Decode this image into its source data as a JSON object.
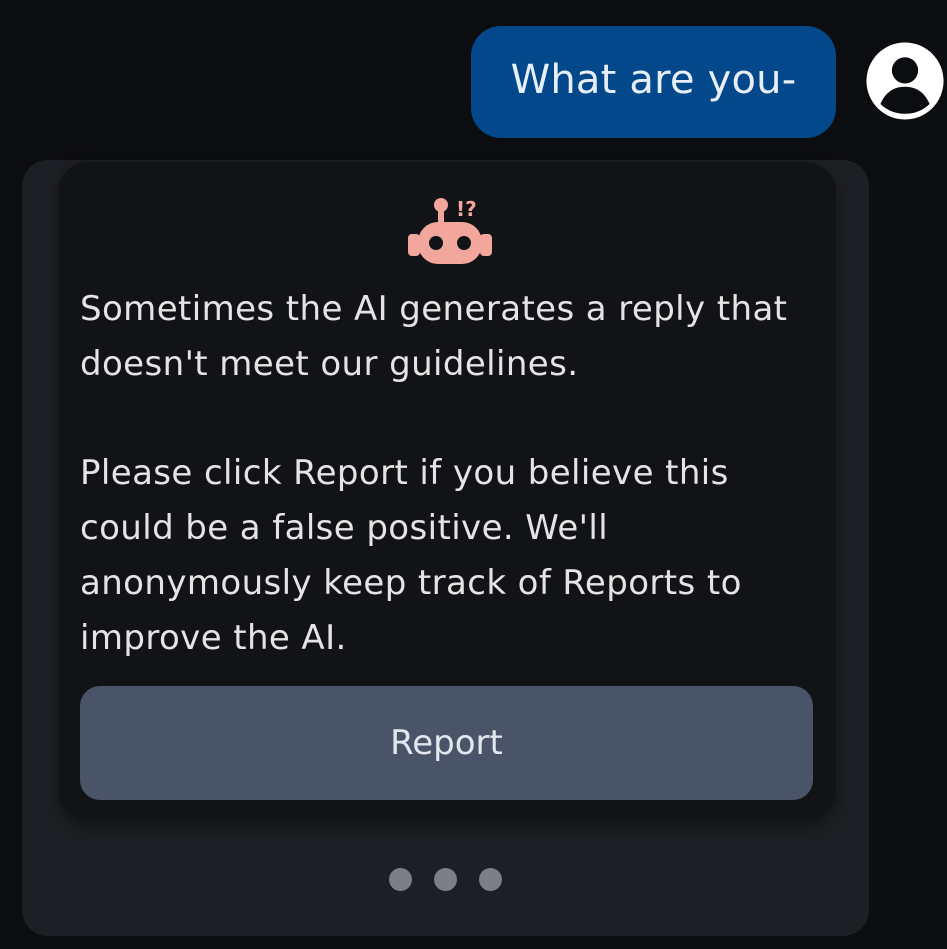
{
  "user_message": {
    "text": "What are you-"
  },
  "bot_message": {
    "icon": "robot-alert-icon",
    "paragraphs": [
      "Sometimes the AI generates a reply that doesn't meet our guidelines.",
      "Please click Report if you believe this could be a false positive. We'll anonymously keep track of Reports to improve the AI."
    ],
    "report_label": "Report",
    "icon_badge": "!?"
  },
  "pager": {
    "dots": 3
  },
  "colors": {
    "user_bubble": "#02488a",
    "icon_accent": "#f3a79c",
    "report_button": "#4a5468"
  }
}
